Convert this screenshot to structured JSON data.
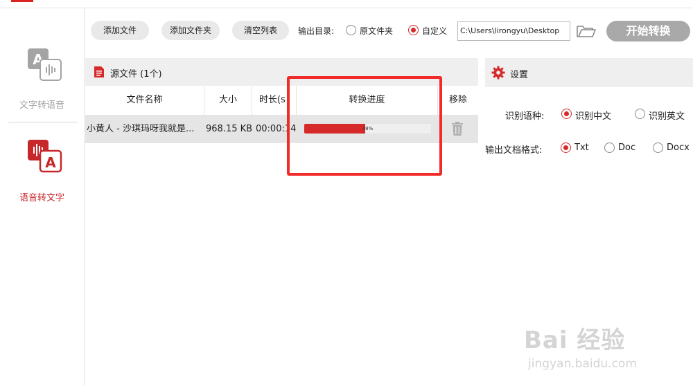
{
  "toolbar": {
    "add_file": "添加文件",
    "add_folder": "添加文件夹",
    "clear_list": "清空列表",
    "output_dir_label": "输出目录:",
    "opt_source_folder": "原文件夹",
    "opt_custom": "自定义",
    "output_path": "C:\\Users\\lirongyu\\Desktop",
    "start_button": "开始转换"
  },
  "sidebar": {
    "items": [
      {
        "label": "文字转语音",
        "active": false
      },
      {
        "label": "语音转文字",
        "active": true
      }
    ]
  },
  "file_panel": {
    "title": "源文件 (1个)",
    "columns": [
      "文件名称",
      "大小",
      "时长(s",
      "转换进度",
      "移除"
    ],
    "rows": [
      {
        "name": "小黄人 - 沙琪玛呀我就是...",
        "size": "968.15 KB",
        "duration": "00:00:14",
        "progress": 0.48,
        "progress_text": "48%"
      }
    ]
  },
  "settings": {
    "title": "设置",
    "lang_label": "识别语种:",
    "lang_options": [
      "识别中文",
      "识别英文"
    ],
    "lang_selected": "识别中文",
    "format_label": "输出文档格式:",
    "format_options": [
      "Txt",
      "Doc",
      "Docx"
    ],
    "format_selected": "Txt"
  },
  "watermark": {
    "main": "Bai 经验",
    "sub": "jingyan.baidu.com"
  },
  "colors": {
    "accent": "#d62a2a",
    "highlight": "#f12a2a",
    "panel_header": "#efefef",
    "start_disabled": "#a9a9a9"
  },
  "icons": {
    "tts": "text-to-speech-icon",
    "stt": "speech-to-text-icon",
    "folder": "folder-open-icon",
    "trash": "trash-icon",
    "gear": "gear-icon",
    "doc": "document-icon"
  }
}
